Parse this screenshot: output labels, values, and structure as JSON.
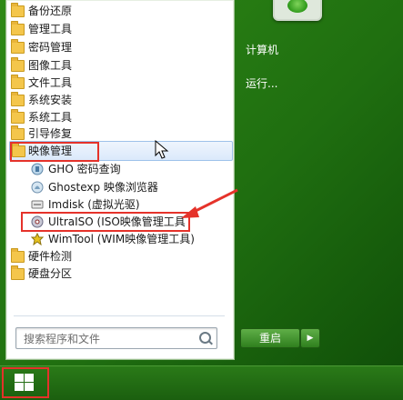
{
  "programs": {
    "folders_top": [
      {
        "label": "备份还原"
      },
      {
        "label": "管理工具"
      },
      {
        "label": "密码管理"
      },
      {
        "label": "图像工具"
      },
      {
        "label": "文件工具"
      },
      {
        "label": "系统安装"
      },
      {
        "label": "系统工具"
      },
      {
        "label": "引导修复"
      }
    ],
    "selected_folder": {
      "label": "映像管理"
    },
    "subitems": [
      {
        "label": "GHO 密码查询"
      },
      {
        "label": "Ghostexp 映像浏览器"
      },
      {
        "label": "Imdisk (虚拟光驱)"
      },
      {
        "label": "UltraISO (ISO映像管理工具"
      },
      {
        "label": "WimTool (WIM映像管理工具)"
      }
    ],
    "folders_bottom": [
      {
        "label": "硬件检测"
      },
      {
        "label": "硬盘分区"
      }
    ]
  },
  "search": {
    "placeholder": "搜索程序和文件"
  },
  "right_pane": {
    "computer_label": "计算机",
    "run_label": "运行..."
  },
  "power": {
    "restart_label": "重启",
    "arrow_label": "▶"
  },
  "colors": {
    "accent": "#2f8a16",
    "highlight_box": "#e5322a",
    "arrow": "#e5322a"
  },
  "icons": {
    "folder": "folder-icon",
    "start": "windows-logo-icon",
    "search": "search-icon"
  }
}
